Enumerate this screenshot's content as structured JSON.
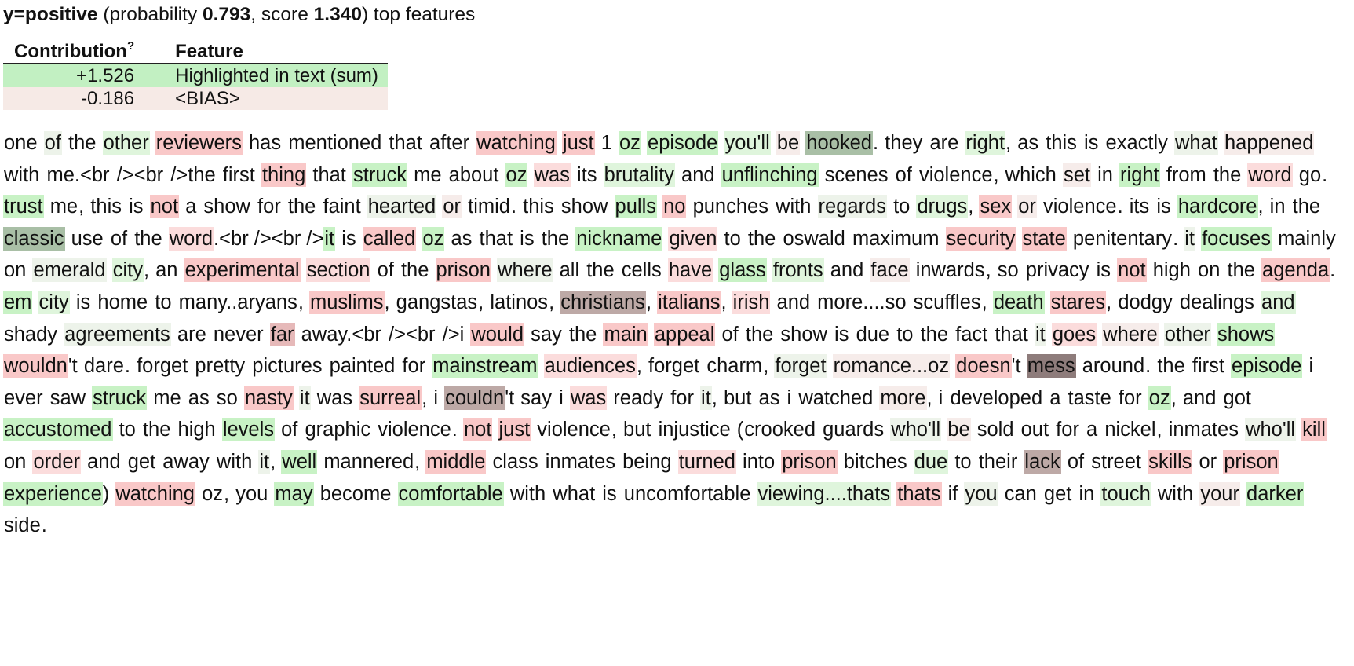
{
  "header": {
    "y_label": "y=positive",
    "prefix": "(probability",
    "probability": "0.793",
    "score_label": ", score",
    "score": "1.340",
    "suffix": ") top features"
  },
  "weights_table": {
    "columns": [
      "Contribution",
      "Feature"
    ],
    "tooltip_mark": "?",
    "rows": [
      {
        "contribution": "+1.526",
        "feature": "Highlighted in text (sum)",
        "color": "#c2f0c2"
      },
      {
        "contribution": "-0.186",
        "feature": "<BIAS>",
        "color": "#f6eae6"
      }
    ]
  },
  "colors": {
    "g1": "#edf3ea",
    "g2": "#dff5dc",
    "g3": "#c8f2c5",
    "g4": "#bfe3bc",
    "g5": "#a9bfa6",
    "r1": "#f6ecea",
    "r2": "#fbdcdc",
    "r3": "#f9c8c8",
    "r4": "#e6b9b9",
    "r5": "#bda9a6",
    "r6": "#8e7c7b"
  },
  "highlighted_text": [
    [
      "one",
      ""
    ],
    " ",
    [
      "of",
      "g1"
    ],
    " ",
    [
      "the",
      ""
    ],
    " ",
    [
      "other",
      "g2"
    ],
    " ",
    [
      "reviewers",
      "r3"
    ],
    " ",
    [
      "has",
      ""
    ],
    " ",
    [
      "mentioned",
      ""
    ],
    " ",
    [
      "that",
      ""
    ],
    " ",
    [
      "after",
      ""
    ],
    " ",
    [
      "watching",
      "r3"
    ],
    " ",
    [
      "just",
      "r3"
    ],
    " ",
    [
      "1",
      ""
    ],
    " ",
    [
      "oz",
      "g3"
    ],
    " ",
    [
      "episode",
      "g3"
    ],
    " ",
    [
      "you'll",
      "g2"
    ],
    " ",
    [
      "be",
      "r1"
    ],
    " ",
    [
      "hooked",
      "g5"
    ],
    ". ",
    [
      "they",
      ""
    ],
    " ",
    [
      "are",
      ""
    ],
    " ",
    [
      "right",
      "g2"
    ],
    ", ",
    [
      "as",
      ""
    ],
    " ",
    [
      "this",
      ""
    ],
    " ",
    [
      "is",
      ""
    ],
    " ",
    [
      "exactly",
      ""
    ],
    " ",
    [
      "what",
      "g1"
    ],
    " ",
    [
      "happened",
      "r1"
    ],
    " ",
    [
      "with",
      ""
    ],
    " ",
    [
      "me.<br",
      ""
    ],
    " ",
    [
      "/><br",
      ""
    ],
    " ",
    [
      "/>the",
      ""
    ],
    " ",
    [
      "first",
      ""
    ],
    " ",
    [
      "thing",
      "r3"
    ],
    " ",
    [
      "that",
      ""
    ],
    " ",
    [
      "struck",
      "g3"
    ],
    " ",
    [
      "me",
      ""
    ],
    " ",
    [
      "about",
      ""
    ],
    " ",
    [
      "oz",
      "g3"
    ],
    " ",
    [
      "was",
      "r2"
    ],
    " ",
    [
      "its",
      ""
    ],
    " ",
    [
      "brutality",
      "g2"
    ],
    " ",
    [
      "and",
      ""
    ],
    " ",
    [
      "unflinching",
      "g3"
    ],
    " ",
    [
      "scenes",
      ""
    ],
    " ",
    [
      "of",
      ""
    ],
    " ",
    [
      "violence",
      ""
    ],
    ", ",
    [
      "which",
      ""
    ],
    " ",
    [
      "set",
      "r1"
    ],
    " ",
    [
      "in",
      ""
    ],
    " ",
    [
      "right",
      "g3"
    ],
    " ",
    [
      "from",
      ""
    ],
    " ",
    [
      "the",
      ""
    ],
    " ",
    [
      "word",
      "r2"
    ],
    " ",
    [
      "go",
      ""
    ],
    ". ",
    [
      "trust",
      "g3"
    ],
    " ",
    [
      "me",
      ""
    ],
    ", ",
    [
      "this",
      ""
    ],
    " ",
    [
      "is",
      ""
    ],
    " ",
    [
      "not",
      "r3"
    ],
    " ",
    [
      "a",
      ""
    ],
    " ",
    [
      "show",
      ""
    ],
    " ",
    [
      "for",
      ""
    ],
    " ",
    [
      "the",
      ""
    ],
    " ",
    [
      "faint",
      ""
    ],
    " ",
    [
      "hearted",
      "g1"
    ],
    " ",
    [
      "or",
      "r1"
    ],
    " ",
    [
      "timid",
      ""
    ],
    ". ",
    [
      "this",
      ""
    ],
    " ",
    [
      "show",
      ""
    ],
    " ",
    [
      "pulls",
      "g3"
    ],
    " ",
    [
      "no",
      "r3"
    ],
    " ",
    [
      "punches",
      ""
    ],
    " ",
    [
      "with",
      ""
    ],
    " ",
    [
      "regards",
      "g1"
    ],
    " ",
    [
      "to",
      ""
    ],
    " ",
    [
      "drugs",
      "g2"
    ],
    ", ",
    [
      "sex",
      "r3"
    ],
    " ",
    [
      "or",
      "r1"
    ],
    " ",
    [
      "violence",
      ""
    ],
    ". ",
    [
      "its",
      ""
    ],
    " ",
    [
      "is",
      ""
    ],
    " ",
    [
      "hardcore",
      "g3"
    ],
    ", ",
    [
      "in",
      ""
    ],
    " ",
    [
      "the",
      ""
    ],
    " ",
    [
      "classic",
      "g5"
    ],
    " ",
    [
      "use",
      ""
    ],
    " ",
    [
      "of",
      ""
    ],
    " ",
    [
      "the",
      ""
    ],
    " ",
    [
      "word",
      "r2"
    ],
    ".<br /><br />",
    [
      "it",
      "g3"
    ],
    " ",
    [
      "is",
      ""
    ],
    " ",
    [
      "called",
      "r3"
    ],
    " ",
    [
      "oz",
      "g3"
    ],
    " ",
    [
      "as",
      ""
    ],
    " ",
    [
      "that",
      ""
    ],
    " ",
    [
      "is",
      ""
    ],
    " ",
    [
      "the",
      ""
    ],
    " ",
    [
      "nickname",
      "g3"
    ],
    " ",
    [
      "given",
      "r2"
    ],
    " ",
    [
      "to",
      ""
    ],
    " ",
    [
      "the",
      ""
    ],
    " ",
    [
      "oswald",
      ""
    ],
    " ",
    [
      "maximum",
      ""
    ],
    " ",
    [
      "security",
      "r3"
    ],
    " ",
    [
      "state",
      "r3"
    ],
    " ",
    [
      "penitentary",
      ""
    ],
    ". ",
    [
      "it",
      "g1"
    ],
    " ",
    [
      "focuses",
      "g3"
    ],
    " ",
    [
      "mainly",
      ""
    ],
    " ",
    [
      "on",
      ""
    ],
    " ",
    [
      "emerald",
      "g1"
    ],
    " ",
    [
      "city",
      "g2"
    ],
    ", ",
    [
      "an",
      ""
    ],
    " ",
    [
      "experimental",
      "r3"
    ],
    " ",
    [
      "section",
      "r2"
    ],
    " ",
    [
      "of",
      ""
    ],
    " ",
    [
      "the",
      ""
    ],
    " ",
    [
      "prison",
      "r3"
    ],
    " ",
    [
      "where",
      "g1"
    ],
    " ",
    [
      "all",
      ""
    ],
    " ",
    [
      "the",
      ""
    ],
    " ",
    [
      "cells",
      ""
    ],
    " ",
    [
      "have",
      "r2"
    ],
    " ",
    [
      "glass",
      "g3"
    ],
    " ",
    [
      "fronts",
      "g2"
    ],
    " ",
    [
      "and",
      ""
    ],
    " ",
    [
      "face",
      "r1"
    ],
    " ",
    [
      "inwards",
      ""
    ],
    ", ",
    [
      "so",
      ""
    ],
    " ",
    [
      "privacy",
      ""
    ],
    " ",
    [
      "is",
      ""
    ],
    " ",
    [
      "not",
      "r3"
    ],
    " ",
    [
      "high",
      ""
    ],
    " ",
    [
      "on",
      ""
    ],
    " ",
    [
      "the",
      ""
    ],
    " ",
    [
      "agenda",
      "r3"
    ],
    ". ",
    [
      "em",
      "g3"
    ],
    " ",
    [
      "city",
      "g2"
    ],
    " ",
    [
      "is",
      ""
    ],
    " ",
    [
      "home",
      ""
    ],
    " ",
    [
      "to",
      ""
    ],
    " ",
    [
      "many..aryans",
      ""
    ],
    ", ",
    [
      "muslims",
      "r3"
    ],
    ", ",
    [
      "gangstas",
      ""
    ],
    ", ",
    [
      "latinos",
      ""
    ],
    ", ",
    [
      "christians",
      "r5"
    ],
    ", ",
    [
      "italians",
      "r3"
    ],
    ", ",
    [
      "irish",
      "r2"
    ],
    " ",
    [
      "and",
      ""
    ],
    " ",
    [
      "more....so",
      ""
    ],
    " ",
    [
      "scuffles",
      ""
    ],
    ", ",
    [
      "death",
      "g3"
    ],
    " ",
    [
      "stares",
      "r3"
    ],
    ", ",
    [
      "dodgy",
      ""
    ],
    " ",
    [
      "dealings",
      ""
    ],
    " ",
    [
      "and",
      "g2"
    ],
    " ",
    [
      "shady",
      ""
    ],
    " ",
    [
      "agreements",
      "g1"
    ],
    " ",
    [
      "are",
      ""
    ],
    " ",
    [
      "never",
      ""
    ],
    " ",
    [
      "far",
      "r4"
    ],
    " ",
    [
      "away.<br",
      ""
    ],
    " ",
    [
      "/><br",
      ""
    ],
    " ",
    [
      "/>i",
      ""
    ],
    " ",
    [
      "would",
      "r3"
    ],
    " ",
    [
      "say",
      ""
    ],
    " ",
    [
      "the",
      ""
    ],
    " ",
    [
      "main",
      "r3"
    ],
    " ",
    [
      "appeal",
      "r3"
    ],
    " ",
    [
      "of",
      ""
    ],
    " ",
    [
      "the",
      ""
    ],
    " ",
    [
      "show",
      ""
    ],
    " ",
    [
      "is",
      ""
    ],
    " ",
    [
      "due",
      ""
    ],
    " ",
    [
      "to",
      ""
    ],
    " ",
    [
      "the",
      ""
    ],
    " ",
    [
      "fact",
      ""
    ],
    " ",
    [
      "that",
      ""
    ],
    " ",
    [
      "it",
      "g1"
    ],
    " ",
    [
      "goes",
      "r2"
    ],
    " ",
    [
      "where",
      "r1"
    ],
    " ",
    [
      "other",
      "g1"
    ],
    " ",
    [
      "shows",
      "g3"
    ],
    " ",
    [
      "wouldn",
      "r3"
    ],
    "'t ",
    [
      "dare",
      ""
    ],
    ". ",
    [
      "forget",
      ""
    ],
    " ",
    [
      "pretty",
      ""
    ],
    " ",
    [
      "pictures",
      ""
    ],
    " ",
    [
      "painted",
      ""
    ],
    " ",
    [
      "for",
      ""
    ],
    " ",
    [
      "mainstream",
      "g3"
    ],
    " ",
    [
      "audiences",
      "r2"
    ],
    ", ",
    [
      "forget",
      ""
    ],
    " ",
    [
      "charm",
      ""
    ],
    ", ",
    [
      "forget",
      "g1"
    ],
    " ",
    [
      "romance...oz",
      "r1"
    ],
    " ",
    [
      "doesn",
      "r3"
    ],
    "'t ",
    [
      "mess",
      "r6"
    ],
    " ",
    [
      "around",
      ""
    ],
    ". ",
    [
      "the",
      ""
    ],
    " ",
    [
      "first",
      ""
    ],
    " ",
    [
      "episode",
      "g3"
    ],
    " ",
    [
      "i",
      ""
    ],
    " ",
    [
      "ever",
      ""
    ],
    " ",
    [
      "saw",
      ""
    ],
    " ",
    [
      "struck",
      "g3"
    ],
    " ",
    [
      "me",
      ""
    ],
    " ",
    [
      "as",
      ""
    ],
    " ",
    [
      "so",
      ""
    ],
    " ",
    [
      "nasty",
      "r3"
    ],
    " ",
    [
      "it",
      "g1"
    ],
    " ",
    [
      "was",
      ""
    ],
    " ",
    [
      "surreal",
      "r3"
    ],
    ", ",
    [
      "i",
      ""
    ],
    " ",
    [
      "couldn",
      "r5"
    ],
    "'t ",
    [
      "say",
      ""
    ],
    " ",
    [
      "i",
      ""
    ],
    " ",
    [
      "was",
      "r2"
    ],
    " ",
    [
      "ready",
      ""
    ],
    " ",
    [
      "for",
      ""
    ],
    " ",
    [
      "it",
      "g1"
    ],
    ", ",
    [
      "but",
      ""
    ],
    " ",
    [
      "as",
      ""
    ],
    " ",
    [
      "i",
      ""
    ],
    " ",
    [
      "watched",
      ""
    ],
    " ",
    [
      "more",
      "r1"
    ],
    ", ",
    [
      "i",
      ""
    ],
    " ",
    [
      "developed",
      ""
    ],
    " ",
    [
      "a",
      ""
    ],
    " ",
    [
      "taste",
      ""
    ],
    " ",
    [
      "for",
      ""
    ],
    " ",
    [
      "oz",
      "g3"
    ],
    ", ",
    [
      "and",
      ""
    ],
    " ",
    [
      "got",
      ""
    ],
    " ",
    [
      "accustomed",
      "g3"
    ],
    " ",
    [
      "to",
      ""
    ],
    " ",
    [
      "the",
      ""
    ],
    " ",
    [
      "high",
      ""
    ],
    " ",
    [
      "levels",
      "g3"
    ],
    " ",
    [
      "of",
      ""
    ],
    " ",
    [
      "graphic",
      ""
    ],
    " ",
    [
      "violence",
      ""
    ],
    ". ",
    [
      "not",
      "r3"
    ],
    " ",
    [
      "just",
      "r3"
    ],
    " ",
    [
      "violence",
      ""
    ],
    ", ",
    [
      "but",
      ""
    ],
    " ",
    [
      "injustice",
      ""
    ],
    " (",
    [
      "crooked",
      ""
    ],
    " ",
    [
      "guards",
      ""
    ],
    " ",
    [
      "who'll",
      "g1"
    ],
    " ",
    [
      "be",
      "r1"
    ],
    " ",
    [
      "sold",
      ""
    ],
    " ",
    [
      "out",
      ""
    ],
    " ",
    [
      "for",
      ""
    ],
    " ",
    [
      "a",
      ""
    ],
    " ",
    [
      "nickel",
      ""
    ],
    ", ",
    [
      "inmates",
      ""
    ],
    " ",
    [
      "who'll",
      "g1"
    ],
    " ",
    [
      "kill",
      "r3"
    ],
    " ",
    [
      "on",
      ""
    ],
    " ",
    [
      "order",
      "r2"
    ],
    " ",
    [
      "and",
      ""
    ],
    " ",
    [
      "get",
      ""
    ],
    " ",
    [
      "away",
      ""
    ],
    " ",
    [
      "with",
      ""
    ],
    " ",
    [
      "it",
      "g1"
    ],
    ", ",
    [
      "well",
      "g3"
    ],
    " ",
    [
      "mannered",
      ""
    ],
    ", ",
    [
      "middle",
      "r3"
    ],
    " ",
    [
      "class",
      ""
    ],
    " ",
    [
      "inmates",
      ""
    ],
    " ",
    [
      "being",
      ""
    ],
    " ",
    [
      "turned",
      "r2"
    ],
    " ",
    [
      "into",
      ""
    ],
    " ",
    [
      "prison",
      "r3"
    ],
    " ",
    [
      "bitches",
      ""
    ],
    " ",
    [
      "due",
      "g2"
    ],
    " ",
    [
      "to",
      ""
    ],
    " ",
    [
      "their",
      ""
    ],
    " ",
    [
      "lack",
      "r5"
    ],
    " ",
    [
      "of",
      ""
    ],
    " ",
    [
      "street",
      ""
    ],
    " ",
    [
      "skills",
      "r3"
    ],
    " ",
    [
      "or",
      ""
    ],
    " ",
    [
      "prison",
      "r3"
    ],
    " ",
    [
      "experience",
      "g3"
    ],
    ") ",
    [
      "watching",
      "r3"
    ],
    " ",
    [
      "oz",
      ""
    ],
    ", ",
    [
      "you",
      ""
    ],
    " ",
    [
      "may",
      "g3"
    ],
    " ",
    [
      "become",
      ""
    ],
    " ",
    [
      "comfortable",
      "g3"
    ],
    " ",
    [
      "with",
      ""
    ],
    " ",
    [
      "what",
      ""
    ],
    " ",
    [
      "is",
      ""
    ],
    " ",
    [
      "uncomfortable",
      ""
    ],
    " ",
    [
      "viewing....thats",
      "g2"
    ],
    " ",
    [
      "thats",
      "r3"
    ],
    " ",
    [
      "if",
      ""
    ],
    " ",
    [
      "you",
      "g1"
    ],
    " ",
    [
      "can",
      ""
    ],
    " ",
    [
      "get",
      ""
    ],
    " ",
    [
      "in",
      ""
    ],
    " ",
    [
      "touch",
      "g2"
    ],
    " ",
    [
      "with",
      ""
    ],
    " ",
    [
      "your",
      "r1"
    ],
    " ",
    [
      "darker",
      "g3"
    ],
    " ",
    [
      "side",
      ""
    ],
    "."
  ]
}
